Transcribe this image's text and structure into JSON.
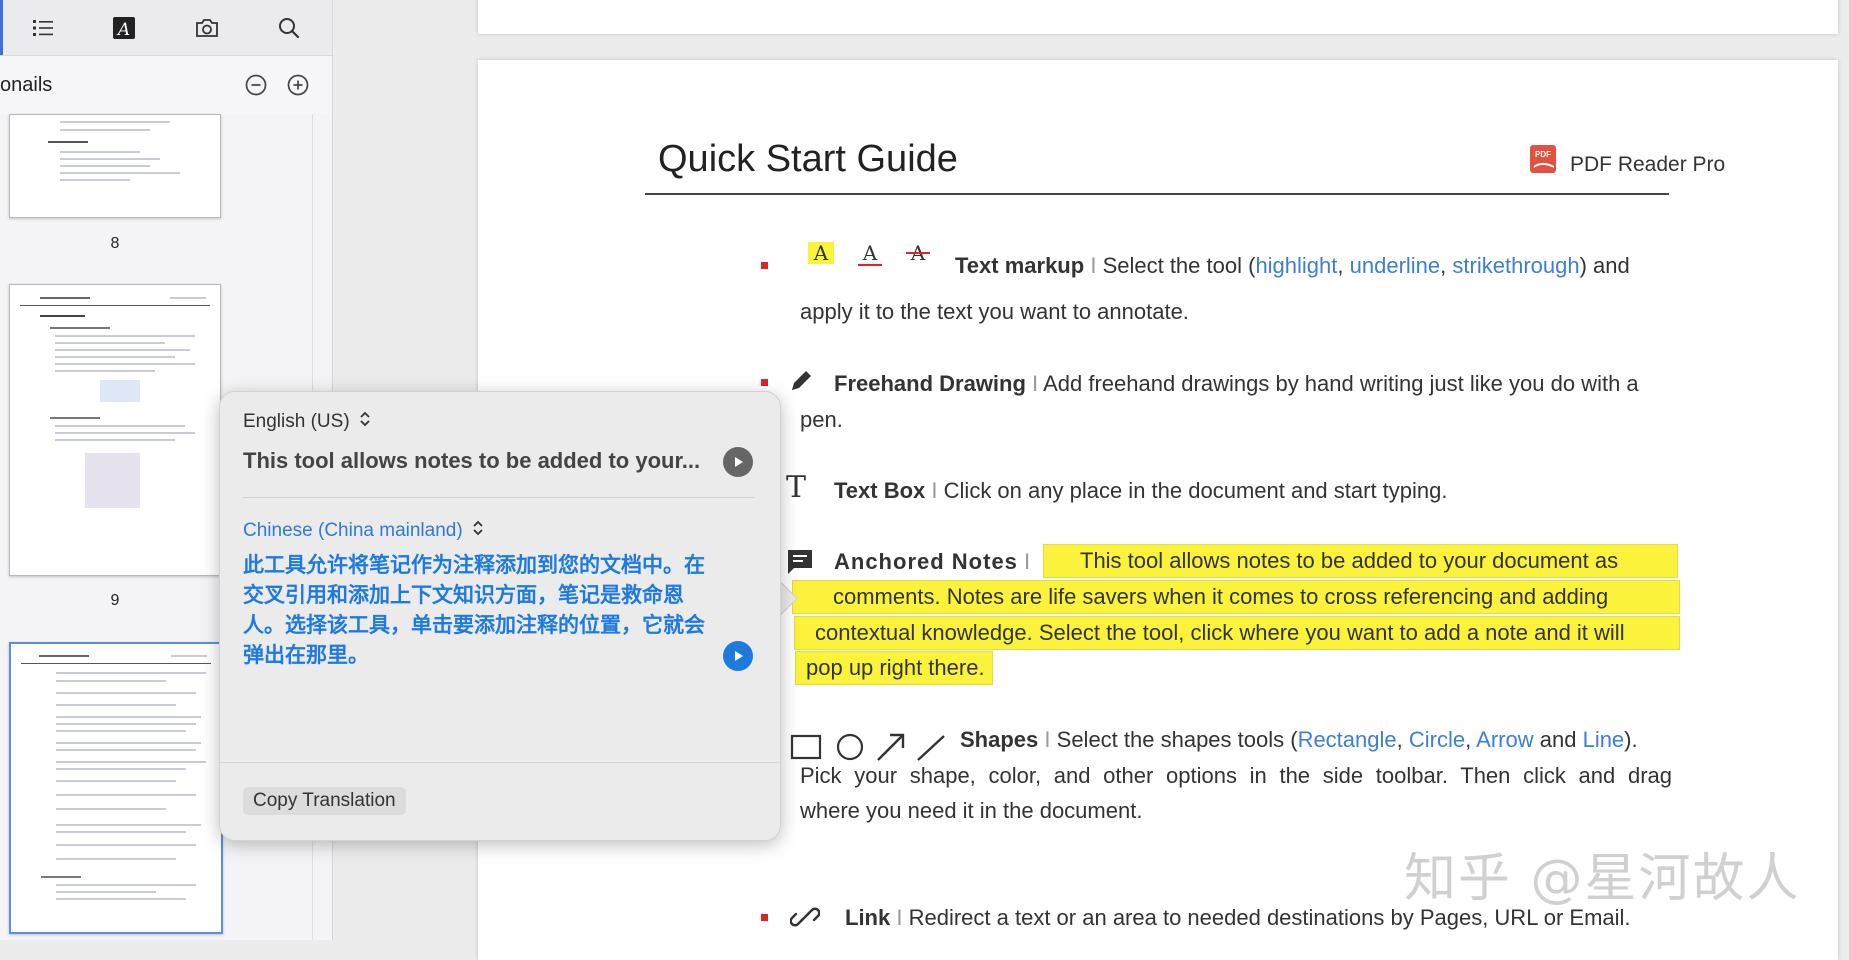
{
  "sidebar": {
    "tools": [
      "outline-icon",
      "annotation-icon",
      "snapshot-icon",
      "search-icon"
    ],
    "title": "onails",
    "thumbnails": [
      {
        "label": "8"
      },
      {
        "label": "9"
      },
      {
        "label": ""
      }
    ]
  },
  "document": {
    "title": "Quick Start Guide",
    "brand": "PDF Reader Pro",
    "items": {
      "text_markup": {
        "heading": "Text markup",
        "sep": "I",
        "pre": "Select the tool (",
        "l1": "highlight",
        "c1": ",",
        "l2": "underline",
        "c2": ",",
        "l3": "strikethrough",
        "post": ") and",
        "line2": "apply it to the text you want to annotate."
      },
      "freehand": {
        "heading": "Freehand Drawing",
        "sep": "I",
        "text": "Add freehand drawings by hand writing just like you do with a",
        "line2": "pen."
      },
      "text_box": {
        "heading": "Text Box",
        "sep": "I",
        "text": "Click on any place in the document and start typing."
      },
      "anchored": {
        "heading": "Anchored Notes",
        "sep": "I",
        "hl1": "This tool allows notes to be added to your document as",
        "hl2": "comments. Notes are life savers when it comes to cross referencing and adding",
        "hl3": "contextual knowledge. Select the tool, click where you want to add a note and it will",
        "hl4": "pop up right there."
      },
      "shapes": {
        "heading": "Shapes",
        "sep": "I",
        "pre": "Select the shapes tools (",
        "l1": "Rectangle",
        "c1": ",",
        "l2": "Circle",
        "c2": ",",
        "l3": "Arrow",
        "and": "and",
        "l4": "Line",
        "post": ").",
        "line2": "Pick your shape, color, and other options in the side toolbar. Then click and drag",
        "line3": "where you need it in the document."
      },
      "link": {
        "heading": "Link",
        "sep": "I",
        "text": "Redirect a text or an area to needed destinations by Pages, URL or Email."
      }
    },
    "watermark": "知乎 @星河故人"
  },
  "translate": {
    "source_lang": "English (US)",
    "source_text": "This tool allows notes to be added to your...",
    "target_lang": "Chinese (China mainland)",
    "target_text": "此工具允许将笔记作为注释添加到您的文档中。在交叉引用和添加上下文知识方面，笔记是救命恩人。选择该工具，单击要添加注释的位置，它就会弹出在那里。",
    "copy_label": "Copy Translation"
  },
  "colors": {
    "accent": "#3f6fd8",
    "link": "#3b7fd6",
    "highlight": "#fbf23c",
    "bullet": "#d9262c",
    "translation": "#1f7ae0"
  }
}
